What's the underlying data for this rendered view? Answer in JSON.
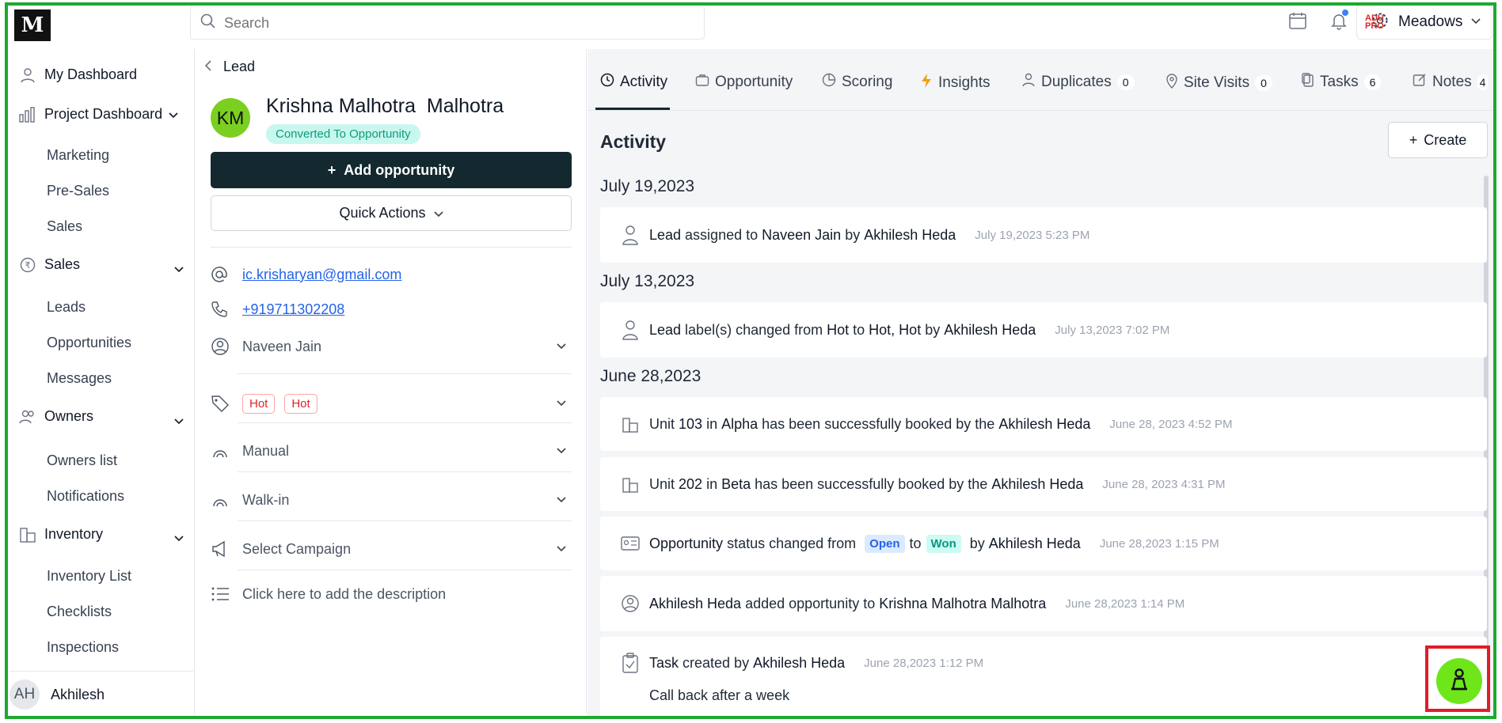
{
  "brand": {
    "logo_text": "M"
  },
  "search": {
    "placeholder": "Search"
  },
  "org": {
    "logo_text": "ADU PRO",
    "name": "Meadows"
  },
  "sidebar": {
    "my_dashboard": "My Dashboard",
    "project_dashboard": "Project Dashboard",
    "project_items": [
      "Marketing",
      "Pre-Sales",
      "Sales"
    ],
    "sales": "Sales",
    "sales_items": [
      "Leads",
      "Opportunities",
      "Messages"
    ],
    "owners": "Owners",
    "owners_items": [
      "Owners list",
      "Notifications"
    ],
    "inventory": "Inventory",
    "inventory_items": [
      "Inventory List",
      "Checklists",
      "Inspections"
    ],
    "user_initials": "AH",
    "user_name": "Akhilesh"
  },
  "lead": {
    "breadcrumb": "Lead",
    "initials": "KM",
    "name": "Krishna Malhotra  Malhotra",
    "status": "Converted To Opportunity",
    "add_opportunity": "Add opportunity",
    "quick_actions": "Quick Actions",
    "email": "ic.krisharyan@gmail.com",
    "phone": "+919711302208",
    "owner": "Naveen Jain",
    "tags": [
      "Hot",
      "Hot"
    ],
    "source": "Manual",
    "sub_source": "Walk-in",
    "campaign": "Select Campaign",
    "description": "Click here to add the description"
  },
  "tabs": [
    {
      "label": "Activity"
    },
    {
      "label": "Opportunity"
    },
    {
      "label": "Scoring"
    },
    {
      "label": "Insights"
    },
    {
      "label": "Duplicates",
      "count": "0"
    },
    {
      "label": "Site Visits",
      "count": "0"
    },
    {
      "label": "Tasks",
      "count": "6"
    },
    {
      "label": "Notes",
      "count": "4"
    }
  ],
  "activity": {
    "title": "Activity",
    "create_label": "Create",
    "dates": [
      "July 19,2023",
      "July 13,2023",
      "June 28,2023"
    ],
    "items": [
      {
        "a": "Lead",
        "b": " assigned to ",
        "c": "Naveen Jain",
        "d": " by ",
        "e": "Akhilesh Heda",
        "ts": "July 19,2023 5:23 PM"
      },
      {
        "a": "Lead",
        "b": " label(s) changed from ",
        "c": "Hot",
        "d": " to ",
        "e": "Hot, Hot",
        "f": " by ",
        "g": "Akhilesh Heda",
        "ts": "July 13,2023 7:02 PM"
      },
      {
        "a": "Unit ",
        "b": "103",
        "c": " in ",
        "d": "Alpha",
        "e": " has been successfully booked by the ",
        "f": "Akhilesh Heda",
        "ts": "June 28, 2023 4:52 PM"
      },
      {
        "a": "Unit ",
        "b": "202",
        "c": " in ",
        "d": "Beta",
        "e": " has been successfully booked by the ",
        "f": "Akhilesh Heda",
        "ts": "June 28, 2023 4:31 PM"
      },
      {
        "a": "Opportunity",
        "b": " status changed from ",
        "open": "Open",
        "c": "to",
        "won": "Won",
        "d": " by ",
        "e": "Akhilesh Heda",
        "ts": "June 28,2023 1:15 PM"
      },
      {
        "a": "Akhilesh Heda",
        "b": " added opportunity to ",
        "c": "Krishna Malhotra Malhotra",
        "ts": "June 28,2023 1:14 PM"
      },
      {
        "a": "Task",
        "b": " created by ",
        "c": "Akhilesh Heda",
        "ts": "June 28,2023 1:12 PM",
        "note": "Call back after a week"
      }
    ]
  },
  "colors": {
    "accent": "#13292f",
    "avatar": "#7bcf21",
    "fab": "#6ee61a",
    "frame": "#1fa82f",
    "highlight": "#e11d2a"
  }
}
